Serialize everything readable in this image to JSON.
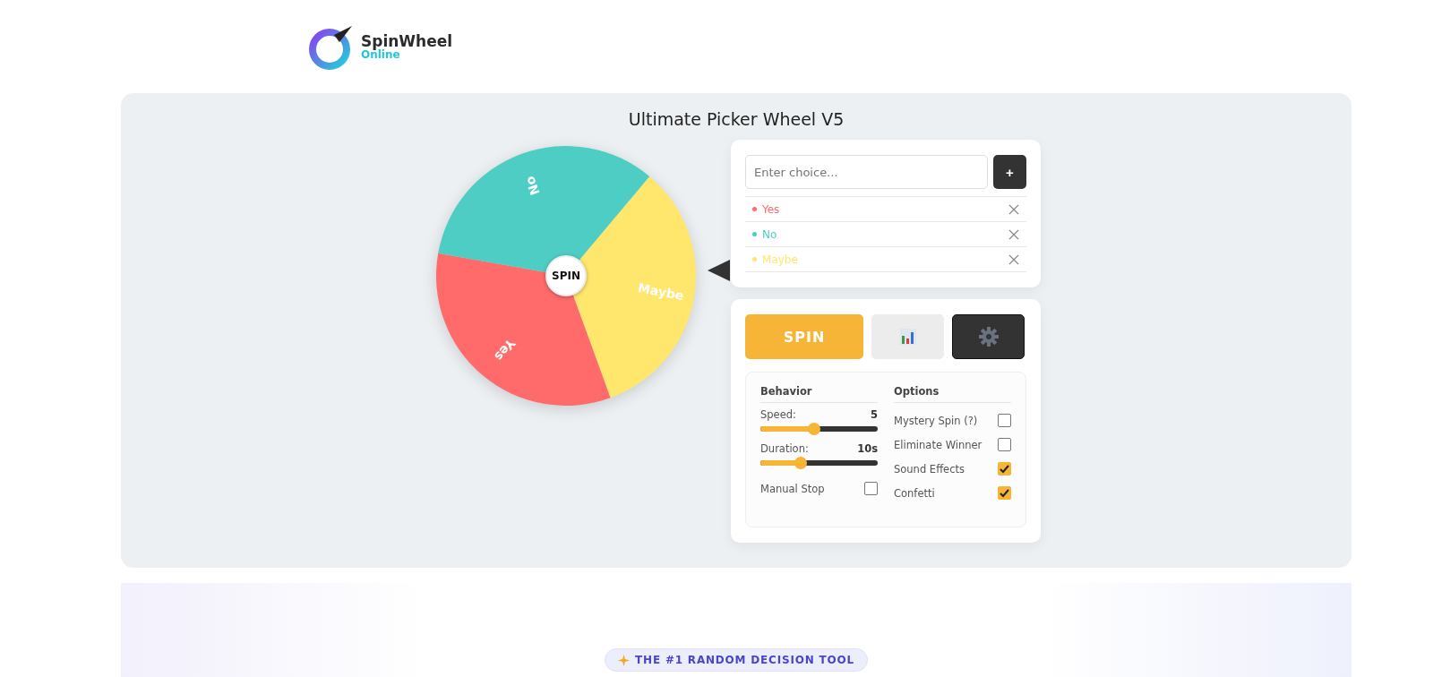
{
  "logo": {
    "name": "SpinWheel",
    "tagline": "Online"
  },
  "title": "Ultimate Picker Wheel V5",
  "wheel": {
    "center_label": "SPIN",
    "segments": [
      {
        "label": "Maybe",
        "color": "#ffe66d"
      },
      {
        "label": "Yes",
        "color": "#ff6b6b"
      },
      {
        "label": "No",
        "color": "#4ecdc4"
      }
    ]
  },
  "choice_input": {
    "placeholder": "Enter choice..."
  },
  "add_button": "+",
  "choices": [
    {
      "label": "Yes",
      "color": "#ff6b6b"
    },
    {
      "label": "No",
      "color": "#4ecdc4"
    },
    {
      "label": "Maybe",
      "color": "#ffe66d"
    }
  ],
  "spin_button": "SPIN",
  "behavior": {
    "heading": "Behavior",
    "sliders": [
      {
        "label": "Speed:",
        "reading": "5",
        "level": 0.46
      },
      {
        "label": "Duration:",
        "reading": "10s",
        "level": 0.34
      }
    ],
    "manual_stop": {
      "label": "Manual Stop",
      "checked": false
    }
  },
  "options": {
    "heading": "Options",
    "items": [
      {
        "label": "Mystery Spin (?)",
        "checked": false
      },
      {
        "label": "Eliminate Winner",
        "checked": false
      },
      {
        "label": "Sound Effects",
        "checked": true
      },
      {
        "label": "Confetti",
        "checked": true
      }
    ]
  },
  "badge": "THE #1 RANDOM DECISION TOOL"
}
